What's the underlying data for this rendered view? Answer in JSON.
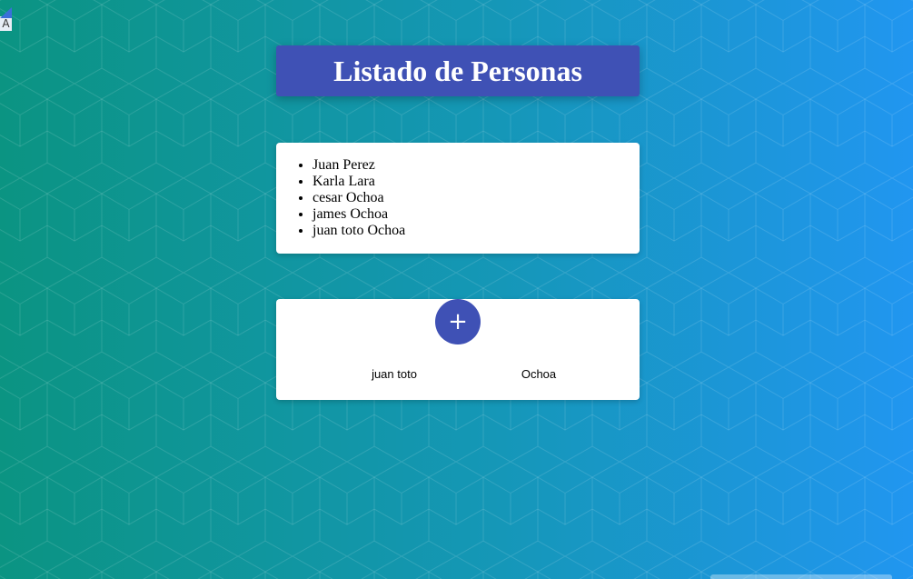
{
  "page": {
    "title": "Listado de Personas"
  },
  "personas": {
    "items": [
      "Juan Perez",
      "Karla Lara",
      "cesar Ochoa",
      "james Ochoa",
      "juan toto Ochoa"
    ]
  },
  "form": {
    "add_label": "+",
    "nombre_value": "juan toto",
    "apellido_value": "Ochoa"
  },
  "corner": {
    "glyph": "A"
  },
  "colors": {
    "primary": "#3f51b5",
    "background_start": "#0b9482",
    "background_end": "#2196f0"
  }
}
